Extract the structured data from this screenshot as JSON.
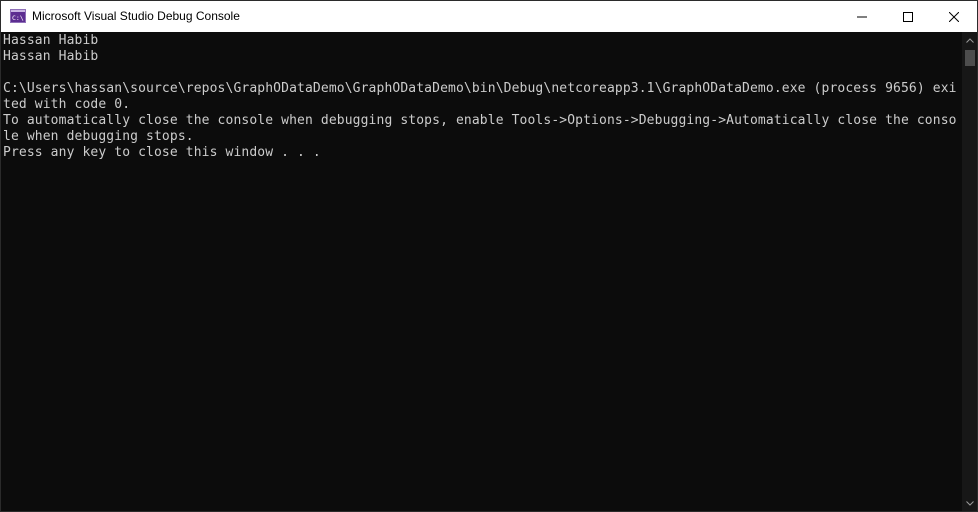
{
  "window": {
    "title": "Microsoft Visual Studio Debug Console",
    "app_icon_text": "C:\\",
    "icons": {
      "app": "console-app-icon",
      "minimize": "minimize-icon",
      "maximize": "maximize-icon",
      "close": "close-icon",
      "scroll_up": "chevron-up-icon",
      "scroll_down": "chevron-down-icon"
    }
  },
  "console": {
    "lines": [
      "Hassan Habib",
      "Hassan Habib",
      "",
      "C:\\Users\\hassan\\source\\repos\\GraphODataDemo\\GraphODataDemo\\bin\\Debug\\netcoreapp3.1\\GraphODataDemo.exe (process 9656) exi",
      "ted with code 0.",
      "To automatically close the console when debugging stops, enable Tools->Options->Debugging->Automatically close the conso",
      "le when debugging stops.",
      "Press any key to close this window . . ."
    ]
  },
  "colors": {
    "background": "#0c0c0c",
    "text": "#cccccc",
    "titlebar": "#ffffff",
    "scrollbar_track": "#171717",
    "scrollbar_thumb": "#4d4d4d"
  }
}
